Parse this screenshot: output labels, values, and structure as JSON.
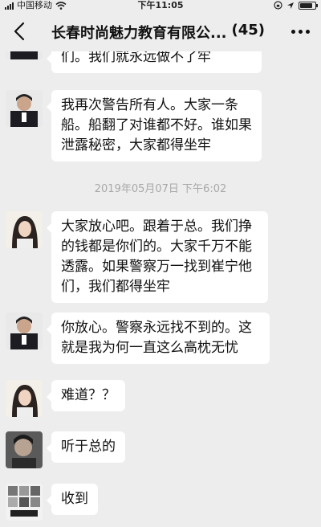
{
  "status_bar": {
    "carrier": "中国移动",
    "time": "下午11:05",
    "battery_level": 0.85
  },
  "header": {
    "title": "长春时尚魅力教育有限公...",
    "member_count": "(45)",
    "back_icon": "chevron-left-icon",
    "more_icon": "more-dots-icon"
  },
  "timestamp": "2019年05月07日 下午6:02",
  "messages": [
    {
      "text": "们。我们就永远做不了牢"
    },
    {
      "text": "我再次警告所有人。大家一条船。船翻了对谁都不好。谁如果泄露秘密，大家都得坐牢"
    },
    {
      "text": "大家放心吧。跟着于总。我们挣的钱都是你们的。大家千万不能透露。如果警察万一找到崔宁他们，我们都得坐牢"
    },
    {
      "text": "你放心。警察永远找不到的。这就是我为何一直这么高枕无忧"
    },
    {
      "text": "难道？？"
    },
    {
      "text": "听于总的"
    },
    {
      "text": "收到"
    }
  ],
  "colors": {
    "background": "#ededed",
    "bubble": "#ffffff",
    "timestamp_text": "#a8a8a8"
  }
}
